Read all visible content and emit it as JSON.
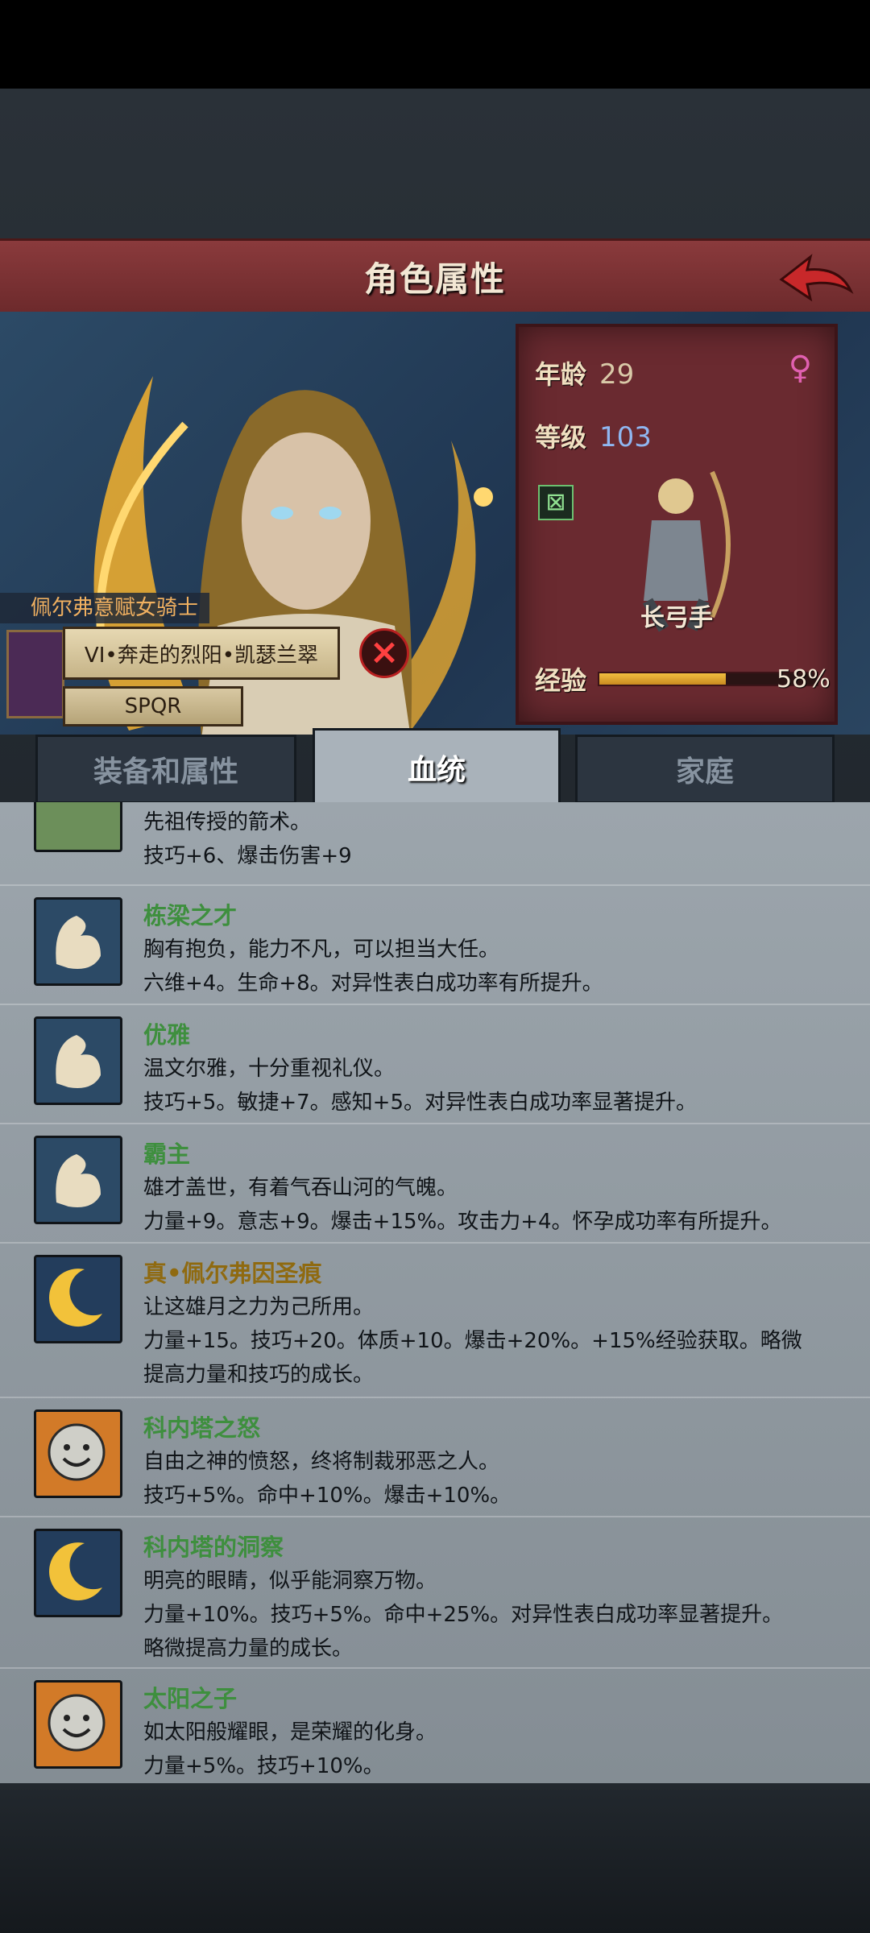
{
  "header": {
    "title": "角色属性"
  },
  "stats": {
    "age_label": "年龄",
    "age": "29",
    "level_label": "等级",
    "level": "103",
    "class_name": "长弓手",
    "exp_label": "经验",
    "exp_percent": "58%",
    "exp_fraction": 0.58
  },
  "identity": {
    "name": "佩尔弗意赋女骑士",
    "title": "VI•奔走的烈阳•凯瑟兰翠",
    "faction": "SPQR"
  },
  "tabs": [
    {
      "label": "装备和属性"
    },
    {
      "label": "血统"
    },
    {
      "label": "家庭"
    }
  ],
  "traits": [
    {
      "name": "",
      "desc": "先祖传授的箭术。",
      "effects": "技巧+6、爆击伤害+9",
      "icon": "branch-icon"
    },
    {
      "name": "栋梁之才",
      "desc": "胸有抱负，能力不凡，可以担当大任。",
      "effects": "六维+4。生命+8。对异性表白成功率有所提升。",
      "icon": "arm-icon"
    },
    {
      "name": "优雅",
      "desc": "温文尔雅，十分重视礼仪。",
      "effects": "技巧+5。敏捷+7。感知+5。对异性表白成功率显著提升。",
      "icon": "arm-icon"
    },
    {
      "name": "霸主",
      "desc": "雄才盖世，有着气吞山河的气魄。",
      "effects": "力量+9。意志+9。爆击+15%。攻击力+4。怀孕成功率有所提升。",
      "icon": "arm-icon"
    },
    {
      "name": "真•佩尔弗因圣痕",
      "desc": "让这雄月之力为己所用。",
      "effects": "力量+15。技巧+20。体质+10。爆击+20%。+15%经验获取。略微\n提高力量和技巧的成长。",
      "icon": "moon-icon"
    },
    {
      "name": "科内塔之怒",
      "desc": "自由之神的愤怒，终将制裁邪恶之人。",
      "effects": "技巧+5%。命中+10%。爆击+10%。",
      "icon": "sun-face-icon"
    },
    {
      "name": "科内塔的洞察",
      "desc": "明亮的眼睛，似乎能洞察万物。",
      "effects": "力量+10%。技巧+5%。命中+25%。对异性表白成功率显著提升。\n略微提高力量的成长。",
      "icon": "moon-icon"
    },
    {
      "name": "太阳之子",
      "desc": "如太阳般耀眼，是荣耀的化身。",
      "effects": "力量+5%。技巧+10%。",
      "icon": "sun-face-icon"
    }
  ]
}
